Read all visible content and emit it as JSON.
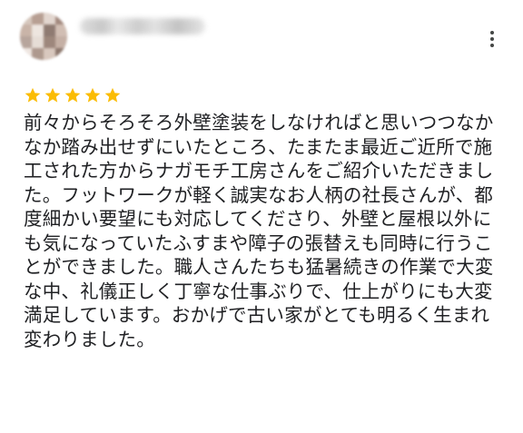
{
  "reviewer": {
    "name": "",
    "avatar_colors": [
      "#d6c7bd",
      "#b79f93",
      "#e2d6cf",
      "#a38a7f",
      "#c9b4a8",
      "#ede5df",
      "#8f7b72",
      "#d1beb3",
      "#b7a59c",
      "#e6ddd6",
      "#9d877c",
      "#c5b0a5",
      "#efe7e2",
      "#ae998e",
      "#d8c8be",
      "#8c776d"
    ]
  },
  "menu": {
    "icon": "more-vert-icon"
  },
  "rating": {
    "value": 5,
    "max": 5,
    "star_color": "#fbbc04"
  },
  "review": {
    "lines": [
      "前々からそろそろ外壁塗装をしなければと思いつつなか",
      "なか踏み出せずにいたところ、たまたま最近ご近所で施",
      "工された方からナガモチ工房さんをご紹介いただきまし",
      "た。フットワークが軽く誠実なお人柄の社長さんが、都",
      "度細かい要望にも対応してくださり、外壁と屋根以外に",
      "も気になっていたふすまや障子の張替えも同時に行うこ",
      "とができました。職人さんたちも猛暑続きの作業で大変",
      "な中、礼儀正しく丁寧な仕事ぶりで、仕上がりにも大変",
      "満足しています。おかげで古い家がとても明るく生まれ",
      "変わりました。"
    ]
  }
}
